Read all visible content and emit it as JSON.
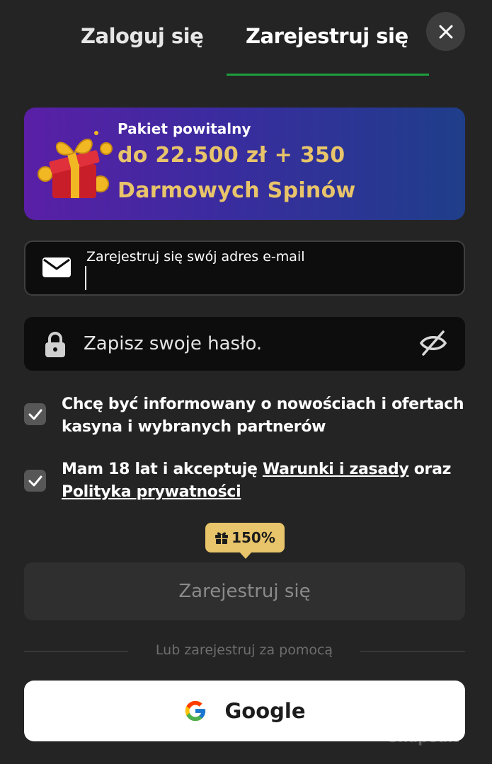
{
  "tabs": {
    "login": "Zaloguj się",
    "register": "Zarejestruj się"
  },
  "banner": {
    "title": "Pakiet powitalny",
    "line1": "do 22.500 zł + 350",
    "line2": "Darmowych Spinów"
  },
  "email": {
    "label": "Zarejestruj się swój adres e-mail",
    "value": ""
  },
  "password": {
    "placeholder": "Zapisz swoje hasło."
  },
  "consents": {
    "newsletter": "Chcę być informowany o nowościach i ofertach kasyna i wybranych partnerów",
    "terms_prefix": "Mam 18 lat i akceptuję",
    "terms_link": "Warunki i zasady",
    "terms_middle": "oraz",
    "privacy_link": "Polityka prywatności"
  },
  "bonus_badge": "150%",
  "register_button": "Zarejestruj się",
  "divider_text": "Lub zarejestruj za pomocą",
  "google_button": "Google",
  "watermark": "Snapedit",
  "colors": {
    "background": "#242424",
    "accent_green": "#1e9e3c",
    "gold": "#e8c46a",
    "banner_start": "#5a1fa6",
    "banner_end": "#1f3e8a"
  }
}
